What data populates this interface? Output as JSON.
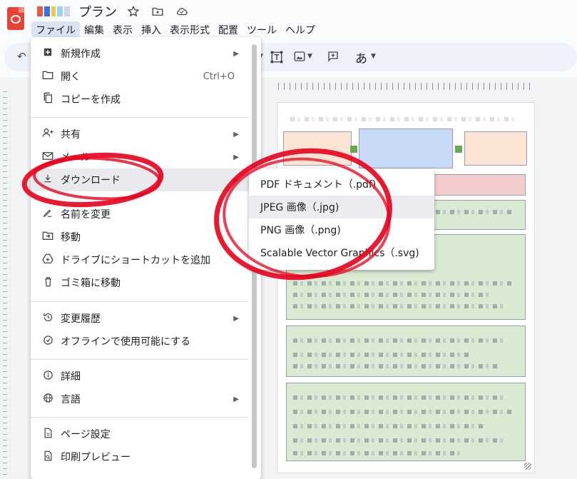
{
  "title": {
    "doc_name": "プラン",
    "thumb_colors": [
      "#e85a3c",
      "#3c6ee8",
      "#f0c848",
      "#9ad4f0"
    ]
  },
  "menubar": [
    "ファイル",
    "編集",
    "表示",
    "挿入",
    "表示形式",
    "配置",
    "ツール",
    "ヘルプ"
  ],
  "toolbar": {
    "text_style": "あ"
  },
  "file_menu": {
    "items": [
      {
        "label": "新規作成",
        "icon": "new-icon",
        "submenu": true
      },
      {
        "label": "開く",
        "icon": "folder-icon",
        "shortcut": "Ctrl+O"
      },
      {
        "label": "コピーを作成",
        "icon": "copy-icon"
      },
      {
        "label": "共有",
        "icon": "share-icon",
        "submenu": true
      },
      {
        "label": "メール",
        "icon": "mail-icon",
        "submenu": true
      },
      {
        "label": "ダウンロード",
        "icon": "download-icon",
        "submenu": true,
        "highlighted": true
      },
      {
        "label": "名前を変更",
        "icon": "rename-icon"
      },
      {
        "label": "移動",
        "icon": "move-icon"
      },
      {
        "label": "ドライブにショートカットを追加",
        "icon": "drive-shortcut-icon"
      },
      {
        "label": "ゴミ箱に移動",
        "icon": "trash-icon"
      },
      {
        "label": "変更履歴",
        "icon": "history-icon",
        "submenu": true
      },
      {
        "label": "オフラインで使用可能にする",
        "icon": "offline-icon"
      },
      {
        "label": "詳細",
        "icon": "info-icon"
      },
      {
        "label": "言語",
        "icon": "globe-icon",
        "submenu": true
      },
      {
        "label": "ページ設定",
        "icon": "page-setup-icon"
      },
      {
        "label": "印刷プレビュー",
        "icon": "print-preview-icon"
      }
    ]
  },
  "download_submenu": {
    "items": [
      {
        "label": "PDF ドキュメント（.pdf)"
      },
      {
        "label": "JPEG 画像（.jpg)",
        "highlighted": true
      },
      {
        "label": "PNG 画像（.png)"
      },
      {
        "label": "Scalable Vector Graphics（.svg)"
      }
    ]
  },
  "colors": {
    "accent": "#dbe3f2",
    "annotation": "#e8001c",
    "menu_highlight": "#e8eaed"
  }
}
